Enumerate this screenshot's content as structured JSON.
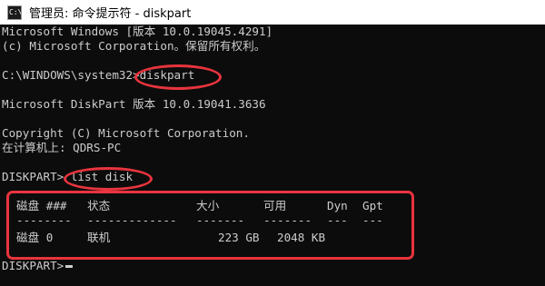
{
  "window": {
    "icon_text": "C:\\",
    "title": "管理员: 命令提示符 - diskpart"
  },
  "console": {
    "lines": [
      "Microsoft Windows [版本 10.0.19045.4291]",
      "(c) Microsoft Corporation。保留所有权利。",
      "",
      "C:\\WINDOWS\\system32>diskpart",
      "",
      "Microsoft DiskPart 版本 10.0.19041.3636",
      "",
      "Copyright (C) Microsoft Corporation.",
      "在计算机上: QDRS-PC",
      "",
      "DISKPART> list disk"
    ],
    "disk_table": {
      "headers": [
        "磁盘 ###",
        "状态",
        "大小",
        "可用",
        "Dyn",
        "Gpt"
      ],
      "separators": [
        "--------",
        "-------------",
        "-------",
        "-------",
        "---",
        "---"
      ],
      "rows": [
        [
          "磁盘 0",
          "联机",
          "223 GB",
          "2048 KB",
          "",
          ""
        ]
      ]
    },
    "prompt": "DISKPART>"
  },
  "colors": {
    "console_background": "#0c0c0c",
    "console_text": "#cccccc",
    "highlight": "#e8343e",
    "titlebar_background": "#ffffff"
  },
  "icons": {
    "app_icon": "cmd-icon"
  }
}
